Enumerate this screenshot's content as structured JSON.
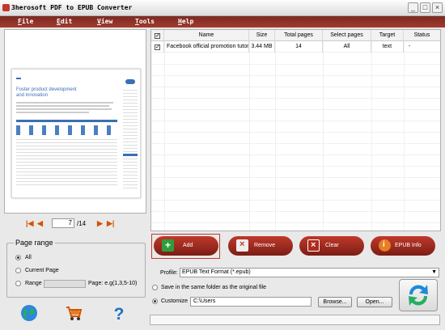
{
  "window": {
    "title": "3herosoft PDF to EPUB Converter",
    "minimize": "_",
    "maximize": "□",
    "close": "×"
  },
  "menu": [
    {
      "key": "F",
      "rest": "ile"
    },
    {
      "key": "E",
      "rest": "dit"
    },
    {
      "key": "V",
      "rest": "iew"
    },
    {
      "key": "T",
      "rest": "ools"
    },
    {
      "key": "H",
      "rest": "elp"
    }
  ],
  "preview": {
    "headline1": "Foster product development",
    "headline2": "and innovation"
  },
  "pager": {
    "current": "7",
    "total": "/14"
  },
  "page_range": {
    "title": "Page range",
    "all": "All",
    "current": "Current Page",
    "range": "Range",
    "range_hint": "Page: e.g(1,3,5-10)",
    "selected": "all"
  },
  "table": {
    "columns": [
      "Name",
      "Size",
      "Total pages",
      "Select pages",
      "Target",
      "Status"
    ],
    "rows": [
      {
        "checked": true,
        "name": "Facebook official promotion tutori",
        "size": "3.44 MB",
        "total_pages": "14",
        "select_pages": "All",
        "target": "text",
        "status": "-"
      }
    ]
  },
  "actions": {
    "add": "Add",
    "remove": "Remove",
    "clear": "Clear",
    "info": "EPUB Info"
  },
  "profile": {
    "label": "Profile:",
    "value": "EPUB Text Format  (*.epub)"
  },
  "output": {
    "same_folder": "Save in the same folder as the original file",
    "customize": "Customize",
    "path": "C:\\Users",
    "browse": "Browse...",
    "open": "Open...",
    "selected": "customize"
  },
  "icons": {
    "globe": "globe-icon",
    "cart": "cart-icon",
    "help": "help-icon",
    "convert": "convert-icon"
  }
}
